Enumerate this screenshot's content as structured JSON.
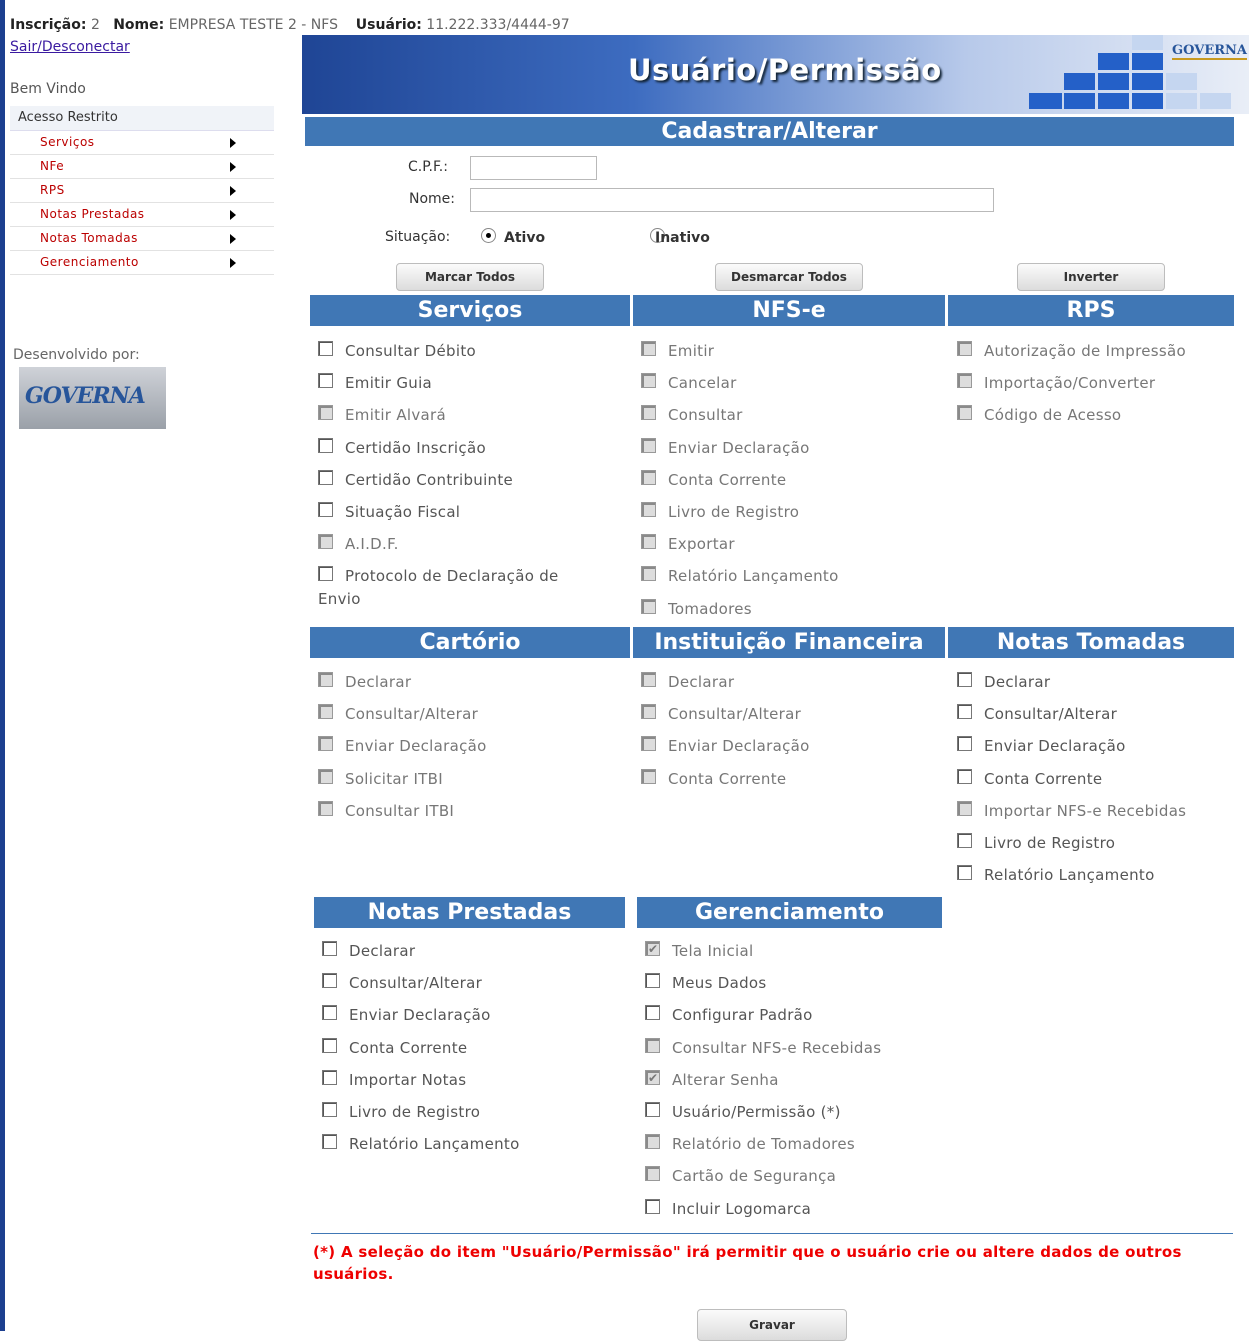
{
  "header": {
    "inscricao_label": "Inscrição:",
    "inscricao_value": "2",
    "nome_label": "Nome:",
    "nome_value": "EMPRESA TESTE 2 - NFS",
    "usuario_label": "Usuário:",
    "usuario_value": "11.222.333/4444-97",
    "logout": "Sair/Desconectar",
    "welcome": "Bem Vindo"
  },
  "menu": {
    "header": "Acesso Restrito",
    "items": [
      "Serviços",
      "NFe",
      "RPS",
      "Notas Prestadas",
      "Notas Tomadas",
      "Gerenciamento"
    ]
  },
  "developer": {
    "label": "Desenvolvido por:",
    "logo_text": "GOVERNA"
  },
  "banner": {
    "title": "Usuário/Permissão",
    "logo_text": "GOVERNA"
  },
  "form": {
    "title": "Cadastrar/Alterar",
    "cpf_label": "C.P.F.:",
    "cpf_value": "",
    "nome_label": "Nome:",
    "nome_value": "",
    "situacao_label": "Situação:",
    "ativo": "Ativo",
    "inativo": "Inativo",
    "situacao_selected": "Ativo"
  },
  "buttons": {
    "marcar": "Marcar Todos",
    "desmarcar": "Desmarcar Todos",
    "inverter": "Inverter",
    "gravar": "Gravar"
  },
  "sections": {
    "servicos": {
      "title": "Serviços",
      "items": [
        {
          "label": "Consultar Débito",
          "state": "unchecked"
        },
        {
          "label": "Emitir Guia",
          "state": "unchecked"
        },
        {
          "label": "Emitir Alvará",
          "state": "disabled"
        },
        {
          "label": "Certidão Inscrição",
          "state": "unchecked"
        },
        {
          "label": "Certidão Contribuinte",
          "state": "unchecked"
        },
        {
          "label": "Situação Fiscal",
          "state": "unchecked"
        },
        {
          "label": "A.I.D.F.",
          "state": "disabled"
        },
        {
          "label": "Protocolo de Declaração de",
          "label2": "Envio",
          "state": "unchecked"
        }
      ]
    },
    "nfse": {
      "title": "NFS-e",
      "items": [
        {
          "label": "Emitir",
          "state": "disabled"
        },
        {
          "label": "Cancelar",
          "state": "disabled"
        },
        {
          "label": "Consultar",
          "state": "disabled"
        },
        {
          "label": "Enviar Declaração",
          "state": "disabled"
        },
        {
          "label": "Conta Corrente",
          "state": "disabled"
        },
        {
          "label": "Livro de Registro",
          "state": "disabled"
        },
        {
          "label": "Exportar",
          "state": "disabled"
        },
        {
          "label": "Relatório Lançamento",
          "state": "disabled"
        },
        {
          "label": "Tomadores",
          "state": "disabled"
        }
      ]
    },
    "rps": {
      "title": "RPS",
      "items": [
        {
          "label": "Autorização de Impressão",
          "state": "disabled"
        },
        {
          "label": "Importação/Converter",
          "state": "disabled"
        },
        {
          "label": "Código de Acesso",
          "state": "disabled"
        }
      ]
    },
    "cartorio": {
      "title": "Cartório",
      "items": [
        {
          "label": "Declarar",
          "state": "disabled"
        },
        {
          "label": "Consultar/Alterar",
          "state": "disabled"
        },
        {
          "label": "Enviar Declaração",
          "state": "disabled"
        },
        {
          "label": "Solicitar ITBI",
          "state": "disabled"
        },
        {
          "label": "Consultar ITBI",
          "state": "disabled"
        }
      ]
    },
    "instituicao": {
      "title": "Instituição Financeira",
      "items": [
        {
          "label": "Declarar",
          "state": "disabled"
        },
        {
          "label": "Consultar/Alterar",
          "state": "disabled"
        },
        {
          "label": "Enviar Declaração",
          "state": "disabled"
        },
        {
          "label": "Conta Corrente",
          "state": "disabled"
        }
      ]
    },
    "tomadas": {
      "title": "Notas Tomadas",
      "items": [
        {
          "label": "Declarar",
          "state": "unchecked"
        },
        {
          "label": "Consultar/Alterar",
          "state": "unchecked"
        },
        {
          "label": "Enviar Declaração",
          "state": "unchecked"
        },
        {
          "label": "Conta Corrente",
          "state": "unchecked"
        },
        {
          "label": "Importar NFS-e Recebidas",
          "state": "disabled"
        },
        {
          "label": "Livro de Registro",
          "state": "unchecked"
        },
        {
          "label": "Relatório Lançamento",
          "state": "unchecked"
        }
      ]
    },
    "prestadas": {
      "title": "Notas Prestadas",
      "items": [
        {
          "label": "Declarar",
          "state": "unchecked"
        },
        {
          "label": "Consultar/Alterar",
          "state": "unchecked"
        },
        {
          "label": "Enviar Declaração",
          "state": "unchecked"
        },
        {
          "label": "Conta Corrente",
          "state": "unchecked"
        },
        {
          "label": "Importar Notas",
          "state": "unchecked"
        },
        {
          "label": "Livro de Registro",
          "state": "unchecked"
        },
        {
          "label": "Relatório Lançamento",
          "state": "unchecked"
        }
      ]
    },
    "gerenciamento": {
      "title": "Gerenciamento",
      "items": [
        {
          "label": "Tela Inicial",
          "state": "checked-disabled"
        },
        {
          "label": "Meus Dados",
          "state": "unchecked"
        },
        {
          "label": "Configurar Padrão",
          "state": "unchecked"
        },
        {
          "label": "Consultar NFS-e Recebidas",
          "state": "disabled"
        },
        {
          "label": "Alterar Senha",
          "state": "checked-disabled"
        },
        {
          "label": "Usuário/Permissão (*)",
          "state": "unchecked"
        },
        {
          "label": "Relatório de Tomadores",
          "state": "disabled"
        },
        {
          "label": "Cartão de Segurança",
          "state": "disabled"
        },
        {
          "label": "Incluir Logomarca",
          "state": "unchecked"
        }
      ]
    }
  },
  "warning": "(*) A seleção do item \"Usuário/Permissão\" irá permitir que o usuário crie ou altere dados de outros usuários.",
  "colors": {
    "section_header": "#4077b5",
    "banner_dark": "#1f4595",
    "warning": "#e00000",
    "menu_link": "#bb0000"
  }
}
